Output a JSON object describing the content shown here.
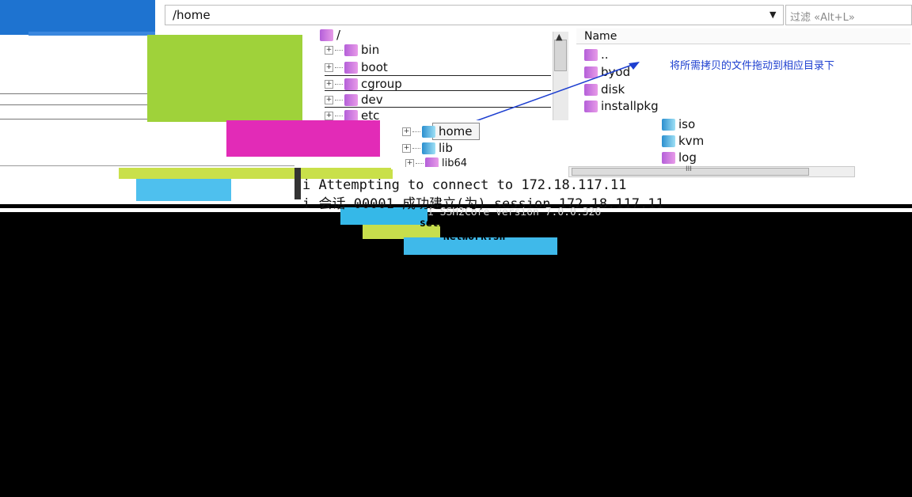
{
  "address_bar": {
    "path": "/home",
    "filter_placeholder": "过滤 «Alt+L»"
  },
  "tree": {
    "top_label": "/",
    "items": [
      {
        "label": "bin"
      },
      {
        "label": "boot"
      },
      {
        "label": "cgroup"
      },
      {
        "label": "dev"
      },
      {
        "label": "etc"
      }
    ],
    "sub_items": [
      {
        "label": "home"
      },
      {
        "label": "lib"
      },
      {
        "label": "lib64"
      }
    ]
  },
  "file_list": {
    "header": "Name",
    "items": [
      {
        "label": ".."
      },
      {
        "label": "byod"
      },
      {
        "label": "disk"
      },
      {
        "label": "installpkg"
      },
      {
        "label": "iso"
      },
      {
        "label": "kvm"
      },
      {
        "label": "log"
      }
    ]
  },
  "annotation": "将所需拷贝的文件拖动到相应目录下",
  "terminal": {
    "lines": [
      "i Attempting to connect to 172.18.117.11",
      "i 会话 00001 成功建立(为) session 172.18.117.11",
      "i SSH2Core version 7.0.0.326",
      "setInternet",
      "Network.sh"
    ]
  },
  "colors": {
    "accent_blue": "#1e73d0",
    "annotation_blue": "#1d3fd0",
    "folder_purple": "#b45fd9",
    "terminal_bg": "#000000"
  }
}
